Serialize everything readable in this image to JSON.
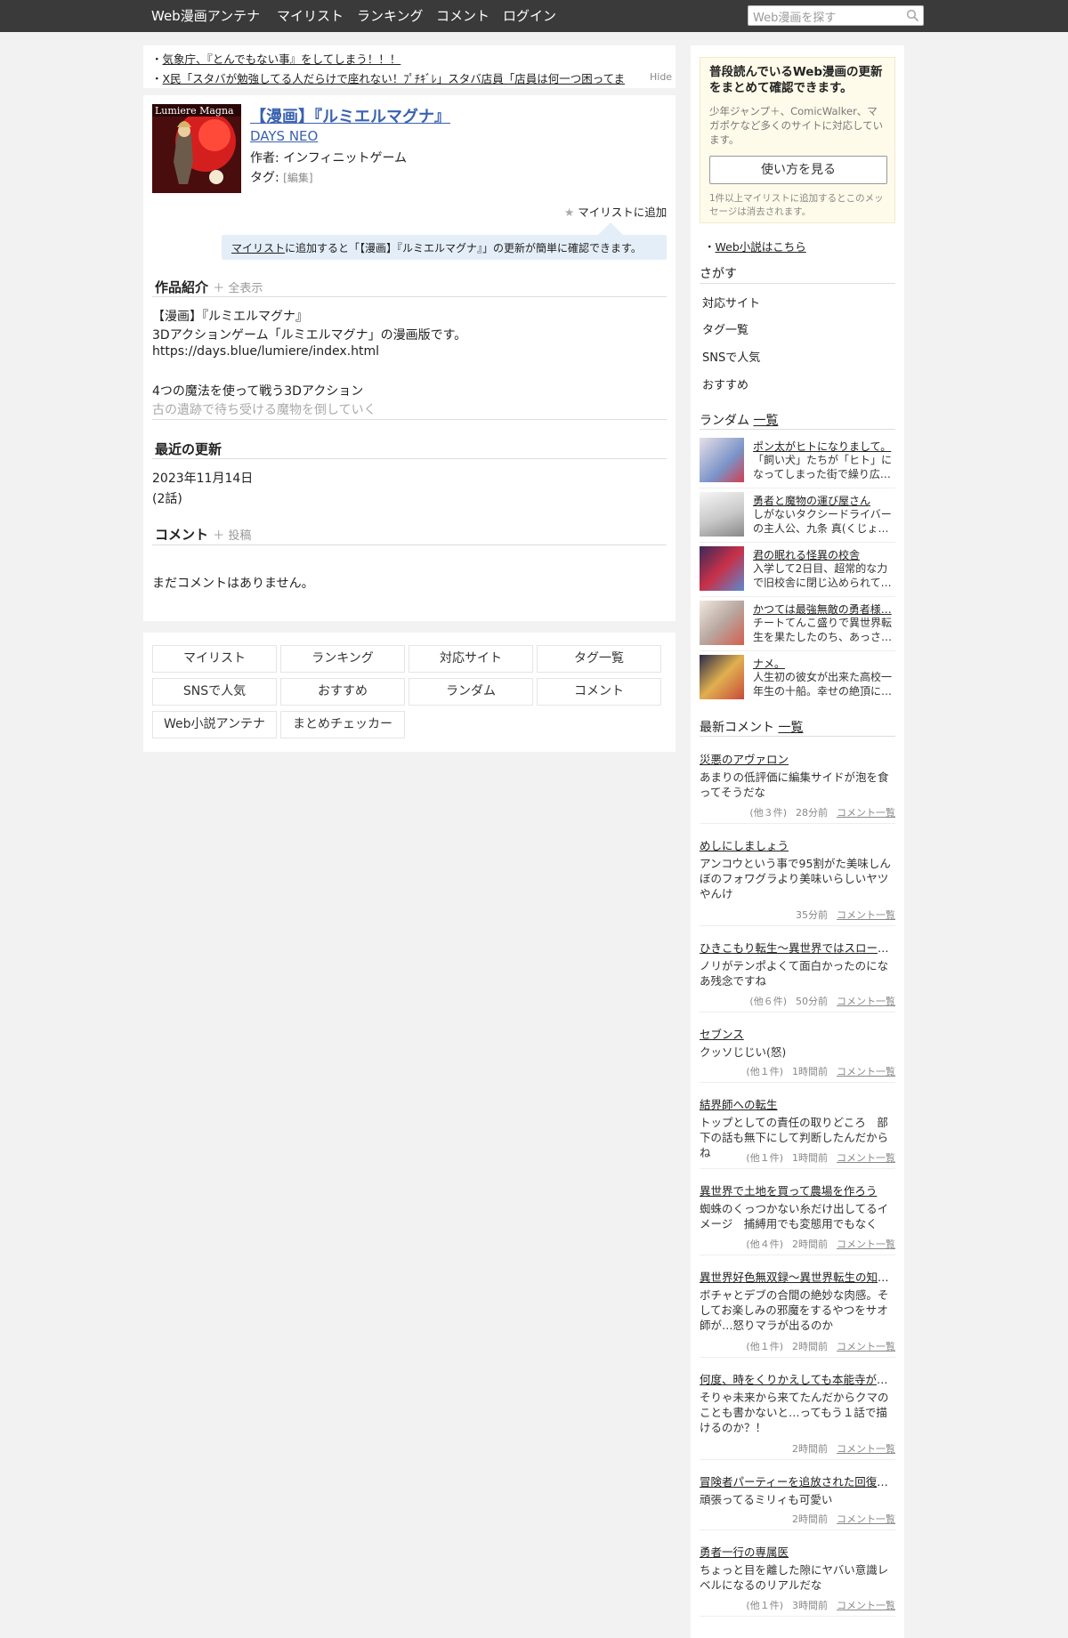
{
  "header": {
    "site_name": "Web漫画アンテナ",
    "nav": [
      "マイリスト",
      "ランキング",
      "コメント",
      "ログイン"
    ],
    "search_placeholder": "Web漫画を探す"
  },
  "news": [
    "気象庁、『とんでもない事』をしてしまう！！！",
    "X民「スタバが勉強してる人だらけで座れない！ﾌﾟﾁｷﾞﾚ」スタバ店員「店員は何一つ困ってま"
  ],
  "news_hide": "Hide",
  "manga": {
    "title": "【漫画】『ルミエルマグナ』",
    "site": "DAYS NEO",
    "author_label": "作者:",
    "author": "インフィニットゲーム",
    "tag_label": "タグ:",
    "tag_edit": "[編集]",
    "cover_text": "Lumiere Magna",
    "mylist_add": "マイリストに追加",
    "mylist_link": "マイリスト",
    "mylist_note": "に追加すると「【漫画】『ルミエルマグナ』」の更新が簡単に確認できます。"
  },
  "intro": {
    "heading": "作品紹介",
    "show_all": "全表示",
    "lines": [
      "【漫画】『ルミエルマグナ』",
      "3Dアクションゲーム「ルミエルマグナ」の漫画版です。",
      "https://days.blue/lumiere/index.html",
      "",
      "4つの魔法を使って戦う3Dアクション",
      "古の遺跡で待ち受ける魔物を倒していく"
    ]
  },
  "updates": {
    "heading": "最近の更新",
    "date": "2023年11月14日",
    "episodes": "(2話)"
  },
  "comments": {
    "heading": "コメント",
    "post": "投稿",
    "empty": "まだコメントはありません。"
  },
  "footer_buttons": [
    "マイリスト",
    "ランキング",
    "対応サイト",
    "タグ一覧",
    "SNSで人気",
    "おすすめ",
    "ランダム",
    "コメント",
    "Web小説アンテナ",
    "まとめチェッカー"
  ],
  "promo": {
    "title": "普段読んでいるWeb漫画の更新をまとめて確認できます。",
    "body": "少年ジャンプ＋、ComicWalker、マガポケなど多くのサイトに対応しています。",
    "button": "使い方を見る",
    "note": "1件以上マイリストに追加するとこのメッセージは消去されます。"
  },
  "novel_link": "Web小説はこちら",
  "search_section": {
    "heading": "さがす",
    "items": [
      "対応サイト",
      "タグ一覧",
      "SNSで人気",
      "おすすめ"
    ]
  },
  "random": {
    "heading": "ランダム",
    "list_link": "一覧",
    "items": [
      {
        "title": "ポン太がヒトになりまして。",
        "desc": "「飼い犬」たちが「ヒト」になってしまった街で繰り広…"
      },
      {
        "title": "勇者と魔物の運び屋さん",
        "desc": "しがないタクシードライバーの主人公、九条 真(くじょ…"
      },
      {
        "title": "君の眠れる怪異の校舎",
        "desc": "入学して2日目、超常的な力で旧校舎に閉じ込められて…"
      },
      {
        "title": "かつては最強無敵の勇者様…",
        "desc": "チートてんこ盛りで異世界転生を果たしたのち、あっさ…"
      },
      {
        "title": "ナメ。",
        "desc": "人生初の彼女が出来た高校一年生の十船。幸せの絶頂に…"
      }
    ]
  },
  "latest": {
    "heading": "最新コメント",
    "list_link": "一覧",
    "link_label": "コメント一覧",
    "items": [
      {
        "title": "災悪のアヴァロン",
        "body": "あまりの低評価に編集サイドが泡を食ってそうだな",
        "count": "(他３件)",
        "time": "28分前"
      },
      {
        "title": "めしにしましょう",
        "body": "アンコウという事で95割がた美味しんぼのフォワグラより美味いらしいヤツやんけ",
        "count": "",
        "time": "35分前"
      },
      {
        "title": "ひきこもり転生～異世界ではスローラ…",
        "body": "ノリがテンポよくて面白かったのになあ残念ですね",
        "count": "(他６件)",
        "time": "50分前"
      },
      {
        "title": "セブンス",
        "body": "クッソじじい(怒)",
        "count": "(他１件)",
        "time": "1時間前"
      },
      {
        "title": "結界師への転生",
        "body": "トップとしての責任の取りどころ　部下の話も無下にして判断したんだからね",
        "count": "(他１件)",
        "time": "1時間前"
      },
      {
        "title": "異世界で土地を買って農場を作ろう",
        "body": "蜘蛛のくっつかない糸だけ出してるイメージ　捕縛用でも変態用でもなく",
        "count": "(他４件)",
        "time": "2時間前"
      },
      {
        "title": "異世界好色無双録～異世界転生の知恵…",
        "body": "ボチャとデブの合間の絶妙な肉感。そしてお楽しみの邪魔をするやつをサオ師が…怒りマラが出るのか",
        "count": "(他１件)",
        "time": "2時間前"
      },
      {
        "title": "何度、時をくりかえしても本能寺が燃…",
        "body": "そりゃ未来から来てたんだからクマのことも書かないと…ってもう１話で描けるのか？！",
        "count": "",
        "time": "2時間前"
      },
      {
        "title": "冒険者パーティーを追放された回復士…",
        "body": "頑張ってるミリィも可愛い",
        "count": "",
        "time": "2時間前"
      },
      {
        "title": "勇者一行の専属医",
        "body": "ちょっと目を離した隙にヤバい意識レベルになるのリアルだな",
        "count": "(他１件)",
        "time": "3時間前"
      }
    ]
  }
}
